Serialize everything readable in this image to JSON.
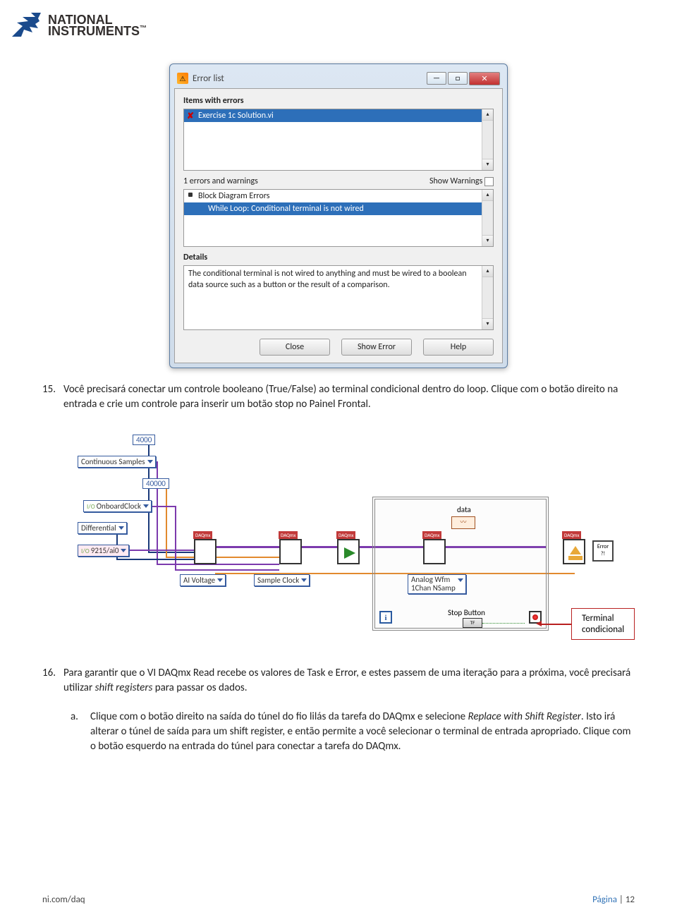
{
  "logo": {
    "text1": "NATIONAL",
    "text2": "INSTRUMENTS",
    "tm": "™"
  },
  "dialog": {
    "title": "Error list",
    "sec1": "Items with errors",
    "item1": "Exercise 1c Solution.vi",
    "stat": "1 errors and warnings",
    "showwarn": "Show Warnings",
    "err_head": "Block Diagram Errors",
    "err_item": "While Loop: Conditional terminal is not wired",
    "sec3": "Details",
    "details": "The conditional terminal is not wired to anything and must be wired to a boolean data source such as a button or the result of a comparison.",
    "btn_close": "Close",
    "btn_show": "Show Error",
    "btn_help": "Help"
  },
  "para15": {
    "num": "15.",
    "text": "Você precisará conectar um controle booleano (True/False) ao terminal condicional dentro do loop. Clique com o botão direito na entrada e crie um controle para inserir um botão stop no Painel Frontal."
  },
  "diagram": {
    "c4000": "4000",
    "cont": "Continuous Samples",
    "c40000": "40000",
    "onboard": "OnboardClock",
    "diff": "Differential",
    "dev": "9215/ai0",
    "aivolt": "AI Voltage",
    "sampclk": "Sample Clock",
    "analog": "Analog Wfm\n1Chan NSamp",
    "data": "data",
    "stopbtn": "Stop Button",
    "tf": "TF",
    "error": "Error",
    "callout": "Terminal\ncondicional"
  },
  "para16": {
    "num": "16.",
    "text_a": "Para garantir que o VI DAQmx Read recebe os valores de Task e Error, e estes passem de uma iteração para a próxima, você precisará utilizar ",
    "shift": "shift registers",
    "text_b": " para passar os dados.",
    "sub_num": "a.",
    "sub_a": "Clique com o botão direito na saída do túnel do fio lilás da tarefa do DAQmx e selecione ",
    "sub_em": "Replace with Shift Register",
    "sub_b": ". Isto irá alterar o túnel de saída para um shift register, e então permite a você selecionar o terminal de entrada apropriado. Clique com o botão esquerdo na entrada do túnel para conectar a tarefa do DAQmx."
  },
  "footer": {
    "url": "ni.com/daq",
    "pg_label": "Página",
    "pg_sep": " | ",
    "pg_num": "12"
  }
}
